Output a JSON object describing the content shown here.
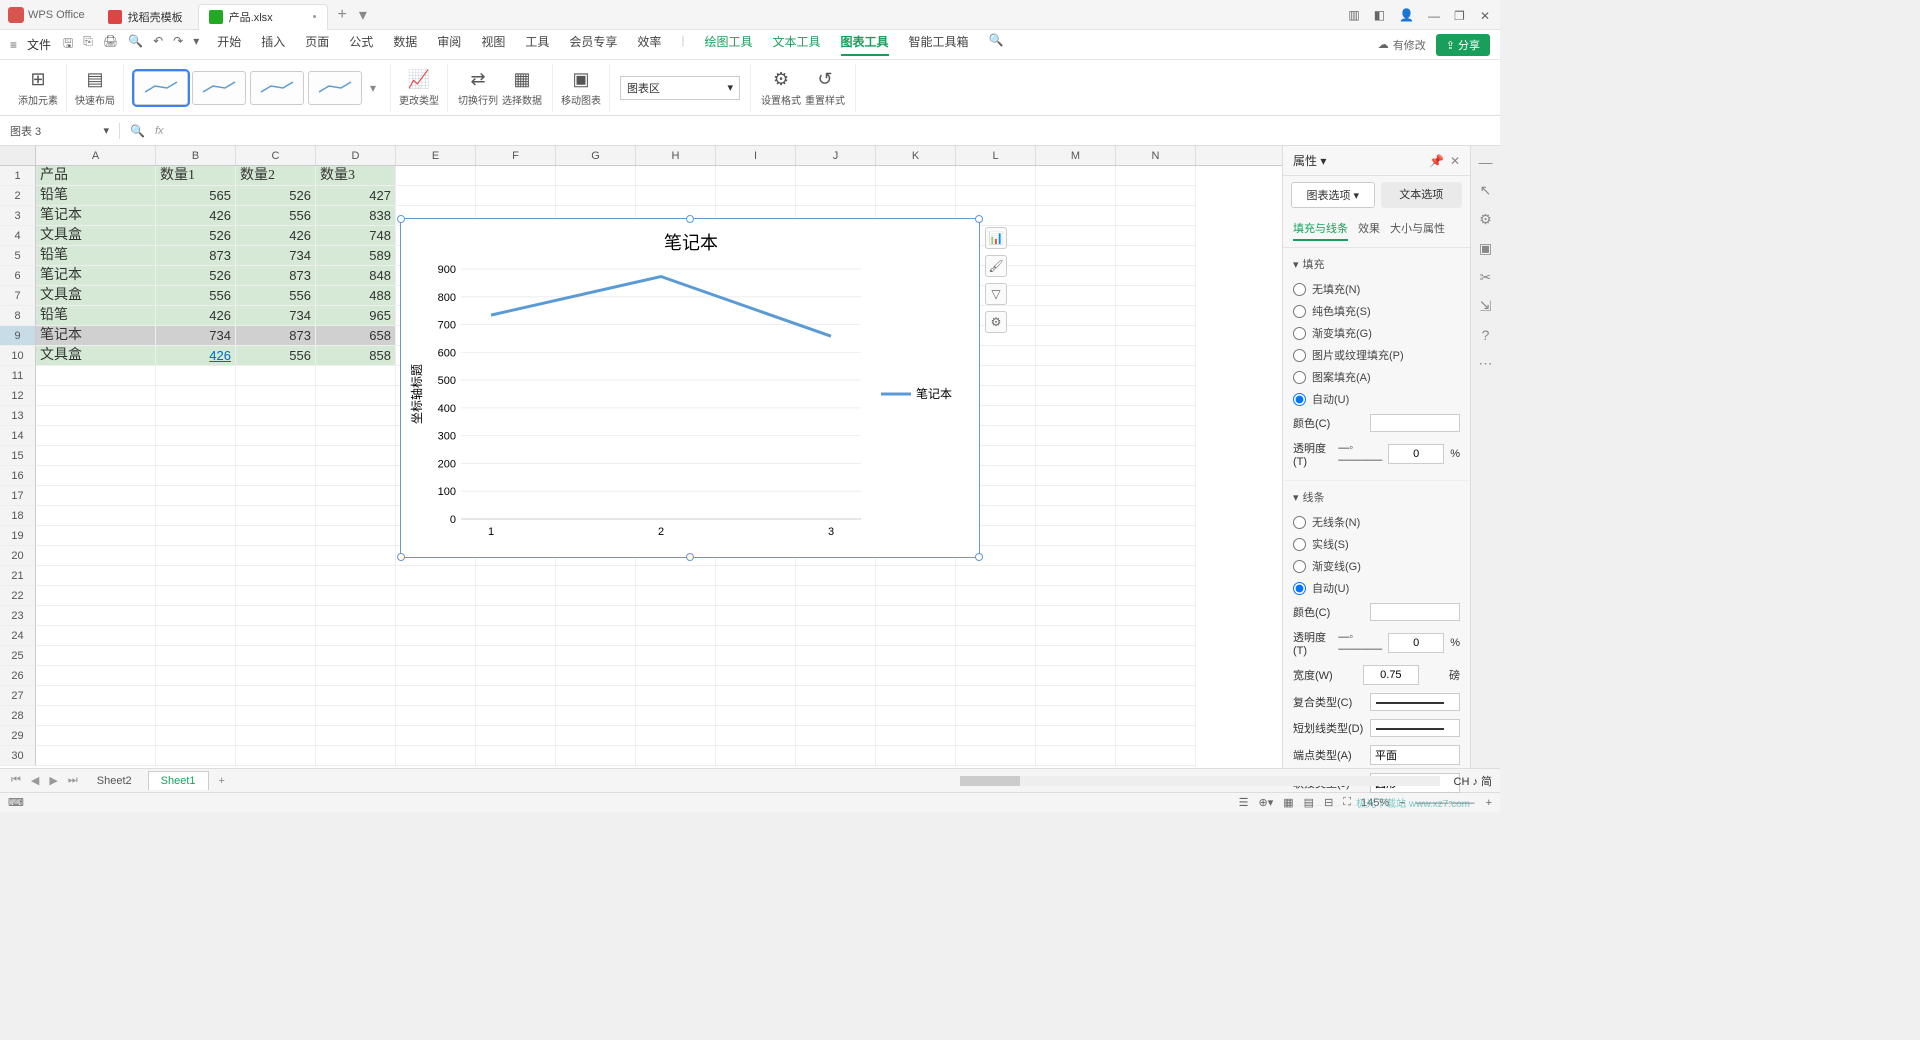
{
  "titlebar": {
    "app_name": "WPS Office",
    "tabs": [
      {
        "label": "找稻壳模板",
        "icon": "red"
      },
      {
        "label": "产品.xlsx",
        "icon": "green",
        "dirty": "•"
      }
    ],
    "add": "+"
  },
  "menurow": {
    "file": "文件",
    "menus": [
      "开始",
      "插入",
      "页面",
      "公式",
      "数据",
      "审阅",
      "视图",
      "工具",
      "会员专享",
      "效率"
    ],
    "extra_menus": [
      "绘图工具",
      "文本工具",
      "图表工具",
      "智能工具箱"
    ],
    "changes": "有修改",
    "share": "分享"
  },
  "ribbon": {
    "add_element": "添加元素",
    "quick_layout": "快速布局",
    "change_type": "更改类型",
    "switch_rowcol": "切换行列",
    "select_data": "选择数据",
    "move_chart": "移动图表",
    "set_format": "设置格式",
    "reset_style": "重置样式",
    "chart_area": "图表区"
  },
  "namebox": "图表 3",
  "columns": [
    "A",
    "B",
    "C",
    "D",
    "E",
    "F",
    "G",
    "H",
    "I",
    "J",
    "K",
    "L",
    "M",
    "N"
  ],
  "rows": [
    1,
    2,
    3,
    4,
    5,
    6,
    7,
    8,
    9,
    10,
    11,
    12,
    13,
    14,
    15,
    16,
    17,
    18,
    19,
    20,
    21,
    22,
    23,
    24,
    25,
    26,
    27,
    28,
    29,
    30
  ],
  "cells": {
    "A1": "产品",
    "B1": "数量1",
    "C1": "数量2",
    "D1": "数量3",
    "A2": "铅笔",
    "B2": "565",
    "C2": "526",
    "D2": "427",
    "A3": "笔记本",
    "B3": "426",
    "C3": "556",
    "D3": "838",
    "A4": "文具盒",
    "B4": "526",
    "C4": "426",
    "D4": "748",
    "A5": "铅笔",
    "B5": "873",
    "C5": "734",
    "D5": "589",
    "A6": "笔记本",
    "B6": "526",
    "C6": "873",
    "D6": "848",
    "A7": "文具盒",
    "B7": "556",
    "C7": "556",
    "D7": "488",
    "A8": "铅笔",
    "B8": "426",
    "C8": "734",
    "D8": "965",
    "A9": "笔记本",
    "B9": "734",
    "C9": "873",
    "D9": "658",
    "A10": "文具盒",
    "B10": "426",
    "C10": "556",
    "D10": "858"
  },
  "chart_data": {
    "type": "line",
    "title": "笔记本",
    "ylabel": "坐标轴标题",
    "x": [
      1,
      2,
      3
    ],
    "series": [
      {
        "name": "笔记本",
        "values": [
          734,
          873,
          658
        ]
      }
    ],
    "ylim": [
      0,
      900
    ],
    "yticks": [
      0,
      100,
      200,
      300,
      400,
      500,
      600,
      700,
      800,
      900
    ]
  },
  "rpanel": {
    "title": "属性",
    "tab_chart": "图表选项",
    "tab_text": "文本选项",
    "sub_fill": "填充与线条",
    "sub_effect": "效果",
    "sub_size": "大小与属性",
    "fill_head": "填充",
    "fill_none": "无填充(N)",
    "fill_solid": "纯色填充(S)",
    "fill_grad": "渐变填充(G)",
    "fill_pict": "图片或纹理填充(P)",
    "fill_patt": "图案填充(A)",
    "fill_auto": "自动(U)",
    "color": "颜色(C)",
    "transparency": "透明度(T)",
    "transparency_val": "0",
    "pct": "%",
    "line_head": "线条",
    "line_none": "无线条(N)",
    "line_solid": "实线(S)",
    "line_grad": "渐变线(G)",
    "line_auto": "自动(U)",
    "width": "宽度(W)",
    "width_val": "0.75",
    "width_unit": "磅",
    "compound": "复合类型(C)",
    "dash": "短划线类型(D)",
    "cap": "端点类型(A)",
    "cap_val": "平面",
    "join": "联接类型(J)",
    "join_val": "圆形"
  },
  "sheets": {
    "s1": "Sheet2",
    "s2": "Sheet1"
  },
  "status": {
    "ime": "CH ♪ 简",
    "zoom": "145%"
  },
  "watermark": "极光下载站 www.xz7.com"
}
